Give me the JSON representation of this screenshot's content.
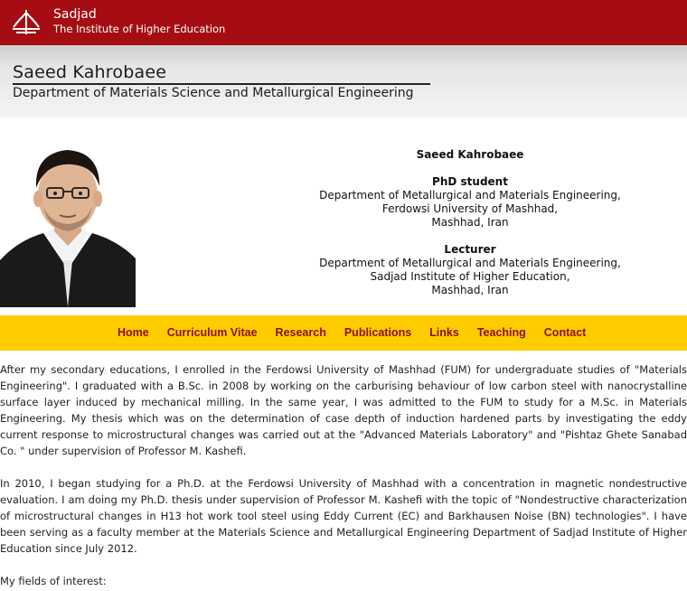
{
  "brand": {
    "name": "Sadjad",
    "subtitle": "The Institute of Higher Education"
  },
  "hero": {
    "name": "Saeed Kahrobaee",
    "department": "Department of Materials Science and Metallurgical Engineering"
  },
  "profile": {
    "name": "Saeed Kahrobaee",
    "role1": {
      "title": "PhD student",
      "line1": "Department of Metallurgical and Materials Engineering,",
      "line2": "Ferdowsi University of Mashhad,",
      "line3": "Mashhad, Iran"
    },
    "role2": {
      "title": "Lecturer",
      "line1": "Department of Metallurgical and Materials Engineering,",
      "line2": "Sadjad Institute of Higher Education,",
      "line3": "Mashhad, Iran"
    }
  },
  "nav": {
    "items": [
      "Home",
      "Curriculum Vitae",
      "Research",
      "Publications",
      "Links",
      "Teaching",
      "Contact"
    ]
  },
  "content": {
    "paragraph1": "After my secondary educations, I enrolled in the Ferdowsi University of Mashhad (FUM) for undergraduate studies of \"Materials Engineering\". I graduated with a B.Sc. in 2008 by working on the carburising behaviour of low carbon steel with nanocrystalline surface layer induced by mechanical milling. In the same year, I was admitted to the FUM to study for a M.Sc. in Materials Engineering. My thesis which was on the determination of case depth of induction hardened parts by investigating the eddy current response to microstructural changes was carried out at the \"Advanced Materials Laboratory\" and \"Pishtaz Ghete Sanabad Co. \" under supervision of Professor M. Kashefi.",
    "paragraph2": "In 2010, I began studying for a Ph.D. at the Ferdowsi University of Mashhad with a concentration in magnetic nondestructive evaluation. I am doing my Ph.D. thesis under supervision of Professor M. Kashefi with the topic of \"Nondestructive characterization of microstructural changes in H13 hot work tool steel using Eddy Current (EC) and Barkhausen Noise (BN) technologies\". I have been serving as a faculty member at the Materials Science and Metallurgical Engineering Department of Sadjad Institute of Higher Education since July 2012.",
    "fields_label": "My fields of interest:"
  }
}
